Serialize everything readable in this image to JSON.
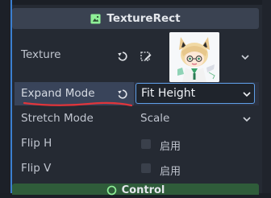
{
  "section": {
    "title": "TextureRect",
    "icon": "texture-rect-icon"
  },
  "properties": {
    "texture": {
      "label": "Texture"
    },
    "expand_mode": {
      "label": "Expand Mode",
      "value": "Fit Height"
    },
    "stretch_mode": {
      "label": "Stretch Mode",
      "value": "Scale"
    },
    "flip_h": {
      "label": "Flip H",
      "checkbox_label": "启用"
    },
    "flip_v": {
      "label": "Flip V",
      "checkbox_label": "启用"
    }
  },
  "next_section": {
    "title": "Control"
  },
  "colors": {
    "accent": "#5f9fe8",
    "annotation": "#e0353b",
    "control_section": "#2f5c3a"
  }
}
